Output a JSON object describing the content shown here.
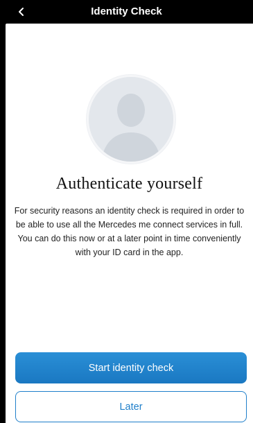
{
  "header": {
    "title": "Identity Check",
    "back_icon": "chevron-left-icon"
  },
  "avatar": {
    "icon": "user-silhouette-icon"
  },
  "content": {
    "headline": "Authenticate yourself",
    "body": "For security reasons an identity check is required in order to be able to use all the Mercedes me connect services in full. You can do this now or at a later point in time conveniently with your ID card in the app."
  },
  "actions": {
    "start_label": "Start identity check",
    "later_label": "Later"
  },
  "colors": {
    "accent": "#1f7fca",
    "header_bg": "#000000",
    "background": "#ffffff"
  }
}
